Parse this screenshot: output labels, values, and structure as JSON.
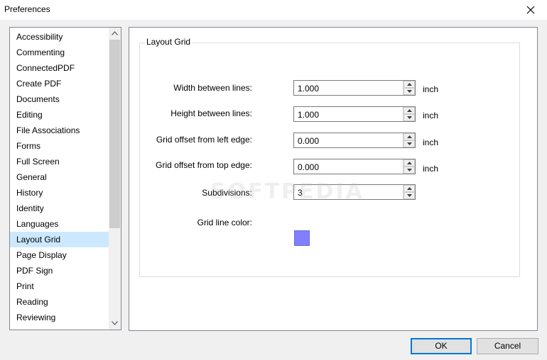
{
  "window": {
    "title": "Preferences"
  },
  "sidebar": {
    "items": [
      {
        "label": "Accessibility"
      },
      {
        "label": "Commenting"
      },
      {
        "label": "ConnectedPDF"
      },
      {
        "label": "Create PDF"
      },
      {
        "label": "Documents"
      },
      {
        "label": "Editing"
      },
      {
        "label": "File Associations"
      },
      {
        "label": "Forms"
      },
      {
        "label": "Full Screen"
      },
      {
        "label": "General"
      },
      {
        "label": "History"
      },
      {
        "label": "Identity"
      },
      {
        "label": "Languages"
      },
      {
        "label": "Layout Grid",
        "selected": true
      },
      {
        "label": "Page Display"
      },
      {
        "label": "PDF Sign"
      },
      {
        "label": "Print"
      },
      {
        "label": "Reading"
      },
      {
        "label": "Reviewing"
      }
    ]
  },
  "layout_grid": {
    "group_title": "Layout Grid",
    "width": {
      "label": "Width between lines:",
      "value": "1.000",
      "unit": "inch"
    },
    "height": {
      "label": "Height between lines:",
      "value": "1.000",
      "unit": "inch"
    },
    "offset_left": {
      "label": "Grid offset from left edge:",
      "value": "0.000",
      "unit": "inch"
    },
    "offset_top": {
      "label": "Grid offset from top edge:",
      "value": "0.000",
      "unit": "inch"
    },
    "subdivisions": {
      "label": "Subdivisions:",
      "value": "3"
    },
    "line_color": {
      "label": "Grid line color:",
      "color": "#8080ff"
    }
  },
  "watermark": "SOFTPEDIA",
  "buttons": {
    "ok": "OK",
    "cancel": "Cancel"
  },
  "colors": {
    "selection": "#cce8ff",
    "accent": "#0078d7"
  }
}
